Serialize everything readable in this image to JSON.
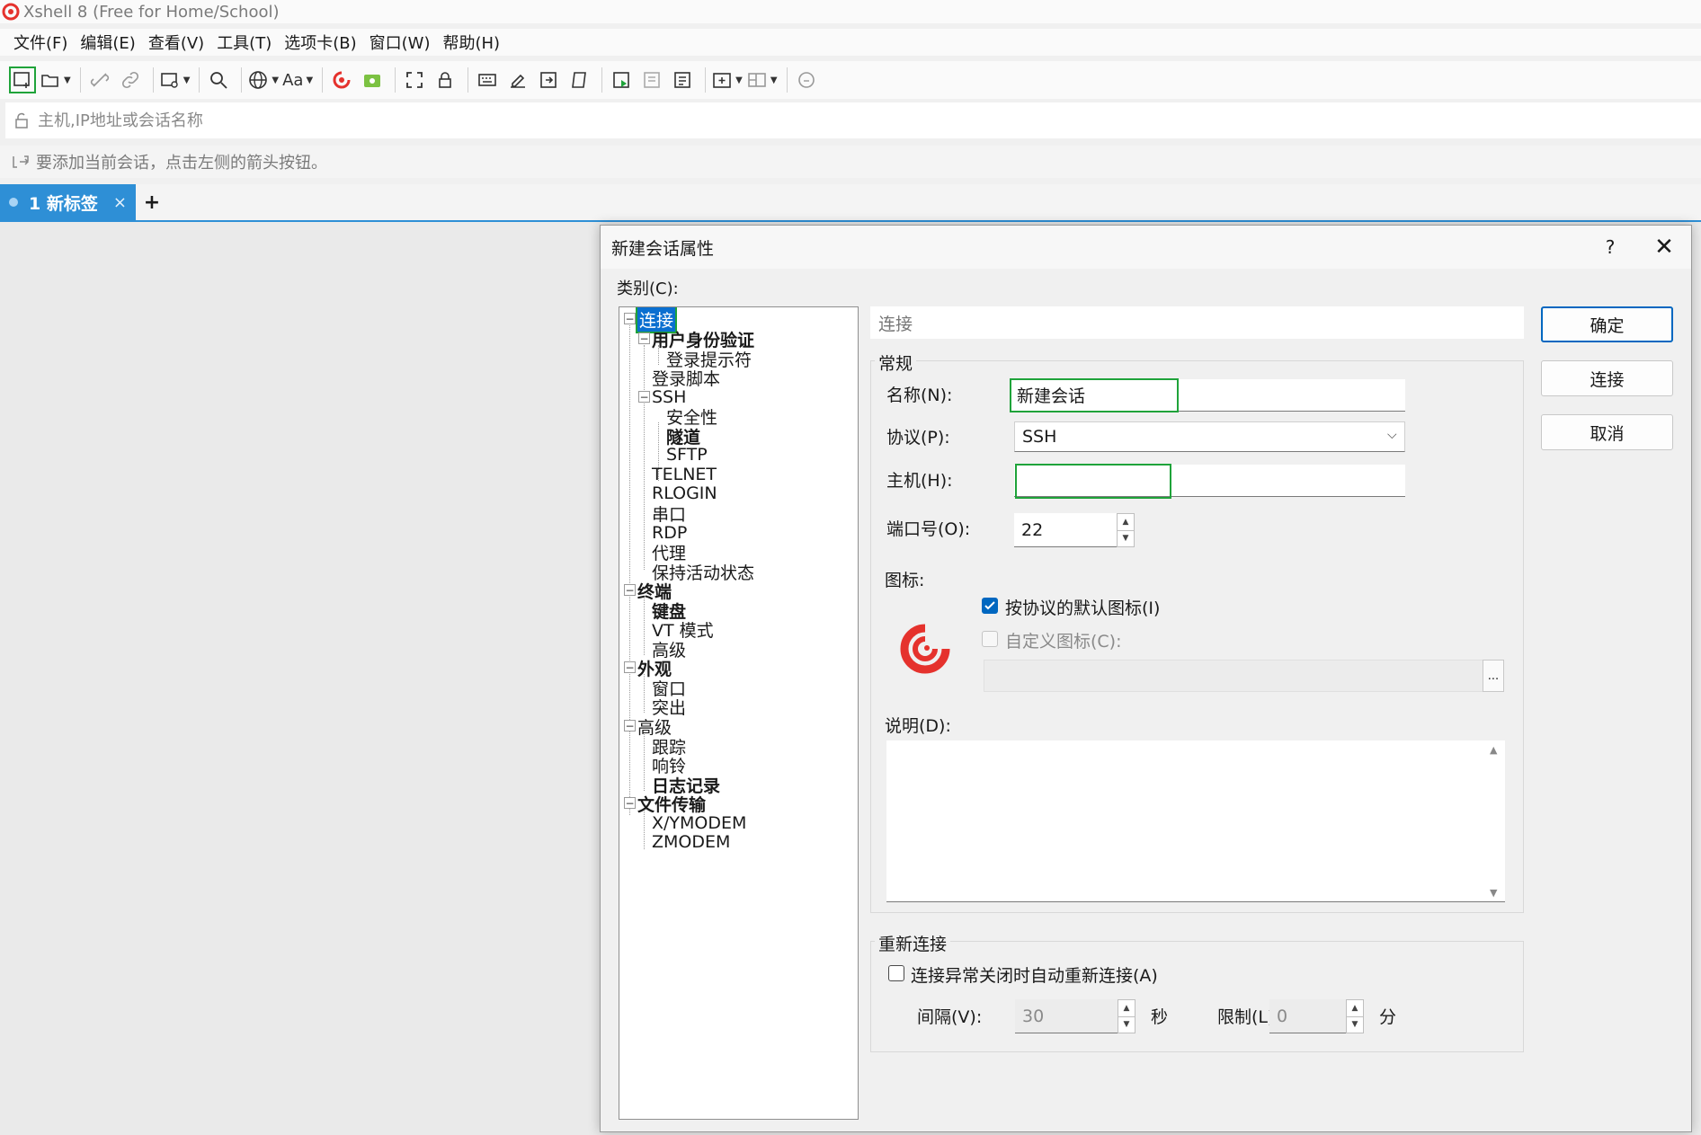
{
  "window": {
    "title": "Xshell 8 (Free for Home/School)"
  },
  "menu": [
    "文件(F)",
    "编辑(E)",
    "查看(V)",
    "工具(T)",
    "选项卡(B)",
    "窗口(W)",
    "帮助(H)"
  ],
  "toolbar": {
    "font_label": "Aa"
  },
  "address": {
    "placeholder": "主机,IP地址或会话名称"
  },
  "hint": {
    "text": "要添加当前会话，点击左侧的箭头按钮。"
  },
  "tabs": [
    {
      "label": "1 新标签",
      "close": "×"
    }
  ],
  "tab_add": "+",
  "dialog": {
    "title": "新建会话属性",
    "help": "?",
    "close": "✕",
    "category_label": "类别(C):",
    "tree": [
      {
        "label": "连接",
        "selected": true
      },
      {
        "label": "用户身份验证"
      },
      {
        "label": "登录提示符"
      },
      {
        "label": "登录脚本"
      },
      {
        "label": "SSH"
      },
      {
        "label": "安全性"
      },
      {
        "label": "隧道"
      },
      {
        "label": "SFTP"
      },
      {
        "label": "TELNET"
      },
      {
        "label": "RLOGIN"
      },
      {
        "label": "串口"
      },
      {
        "label": "RDP"
      },
      {
        "label": "代理"
      },
      {
        "label": "保持活动状态"
      },
      {
        "label": "终端"
      },
      {
        "label": "键盘"
      },
      {
        "label": "VT 模式"
      },
      {
        "label": "高级"
      },
      {
        "label": "外观"
      },
      {
        "label": "窗口"
      },
      {
        "label": "突出"
      },
      {
        "label": "高级"
      },
      {
        "label": "跟踪"
      },
      {
        "label": "响铃"
      },
      {
        "label": "日志记录"
      },
      {
        "label": "文件传输"
      },
      {
        "label": "X/YMODEM"
      },
      {
        "label": "ZMODEM"
      }
    ],
    "section_header": "连接",
    "general": {
      "group_title": "常规",
      "name_label": "名称(N):",
      "name_value": "新建会话",
      "protocol_label": "协议(P):",
      "protocol_value": "SSH",
      "host_label": "主机(H):",
      "host_value": "",
      "port_label": "端口号(O):",
      "port_value": "22",
      "icon_label": "图标:",
      "default_icon_label": "按协议的默认图标(I)",
      "default_icon_checked": true,
      "custom_icon_label": "自定义图标(C):",
      "custom_icon_checked": false,
      "browse_label": "...",
      "description_label": "说明(D):",
      "description_value": ""
    },
    "reconnect": {
      "group_title": "重新连接",
      "auto_label": "连接异常关闭时自动重新连接(A)",
      "auto_checked": false,
      "interval_label": "间隔(V):",
      "interval_value": "30",
      "interval_unit": "秒",
      "limit_label": "限制(L):",
      "limit_value": "0",
      "limit_unit": "分"
    },
    "buttons": {
      "ok": "确定",
      "connect": "连接",
      "cancel": "取消"
    }
  },
  "colors": {
    "accent": "#2e8fd6",
    "highlight": "#1fa33a",
    "selection": "#0a6fd0",
    "logo": "#e5322d"
  }
}
